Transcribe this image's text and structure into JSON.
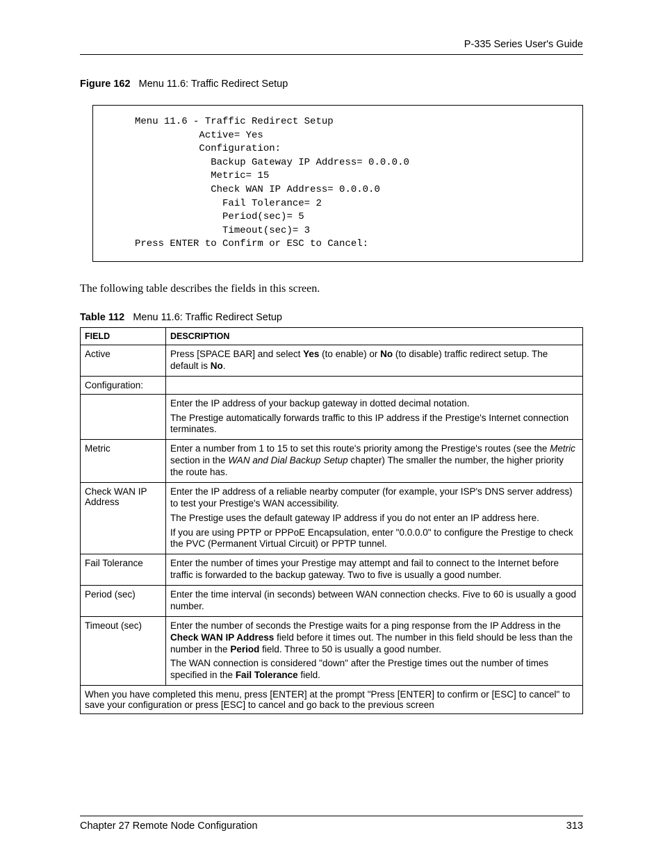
{
  "header": {
    "guide_title": "P-335 Series User's Guide"
  },
  "figure": {
    "label": "Figure 162",
    "title": "Menu 11.6: Traffic Redirect Setup",
    "code": "     Menu 11.6 - Traffic Redirect Setup\n                Active= Yes\n                Configuration:\n                  Backup Gateway IP Address= 0.0.0.0\n                  Metric= 15\n                  Check WAN IP Address= 0.0.0.0\n                    Fail Tolerance= 2\n                    Period(sec)= 5\n                    Timeout(sec)= 3\n     Press ENTER to Confirm or ESC to Cancel:"
  },
  "intro_para": "The following table describes the fields in this screen.",
  "table": {
    "label": "Table 112",
    "title": "Menu 11.6: Traffic Redirect Setup",
    "head_field": "FIELD",
    "head_desc": "DESCRIPTION",
    "rows": {
      "active": {
        "field": "Active",
        "p1a": "Press [SPACE BAR] and select ",
        "yes": "Yes",
        "p1b": " (to enable) or ",
        "no": "No",
        "p1c": " (to disable) traffic redirect setup. The default is ",
        "no2": "No",
        "p1d": "."
      },
      "configuration": {
        "field": "Configuration:"
      },
      "backup": {
        "p1": "Enter the IP address of your backup gateway in dotted decimal notation.",
        "p2": "The Prestige automatically forwards traffic to this IP address if the Prestige's Internet connection terminates."
      },
      "metric": {
        "field": "Metric",
        "p1a": "Enter a number from 1 to 15 to set this route's priority among the Prestige's routes (see the ",
        "i1": "Metric",
        "p1b": " section in the ",
        "i2": "WAN and Dial Backup Setup",
        "p1c": " chapter) The smaller the number, the higher priority the route has."
      },
      "checkwan": {
        "field": "Check WAN IP Address",
        "p1": "Enter the IP address of a reliable nearby computer (for example, your ISP's DNS server address) to test your Prestige's WAN accessibility.",
        "p2": "The Prestige uses the default gateway IP address if you do not enter an IP address here.",
        "p3": "If you are using PPTP or PPPoE Encapsulation, enter \"0.0.0.0\" to configure the Prestige to check the PVC (Permanent Virtual Circuit) or PPTP tunnel."
      },
      "failtol": {
        "field": "Fail Tolerance",
        "p1": "Enter the number of times your Prestige may attempt and fail to connect to the Internet before traffic is forwarded to the backup gateway. Two to five is usually a good number."
      },
      "period": {
        "field": "Period (sec)",
        "p1": "Enter the time interval (in seconds) between WAN connection checks. Five to 60 is usually a good number."
      },
      "timeout": {
        "field": "Timeout (sec)",
        "p1a": "Enter the number of seconds the Prestige waits for a ping response from the IP Address in the ",
        "b1": "Check WAN IP Address",
        "p1b": " field before it times out. The number in this field should be less than the number in the ",
        "b2": "Period",
        "p1c": " field. Three to 50 is usually a good number.",
        "p2a": "The WAN connection is considered \"down\" after the Prestige times out the number of times specified in the ",
        "b3": "Fail Tolerance",
        "p2b": " field."
      },
      "footnote": "When you have completed this menu, press [ENTER] at the prompt \"Press [ENTER] to confirm or [ESC] to cancel\" to save your configuration or press [ESC] to cancel and go back to the previous screen"
    }
  },
  "footer": {
    "chapter": "Chapter 27 Remote Node Configuration",
    "page": "313"
  }
}
